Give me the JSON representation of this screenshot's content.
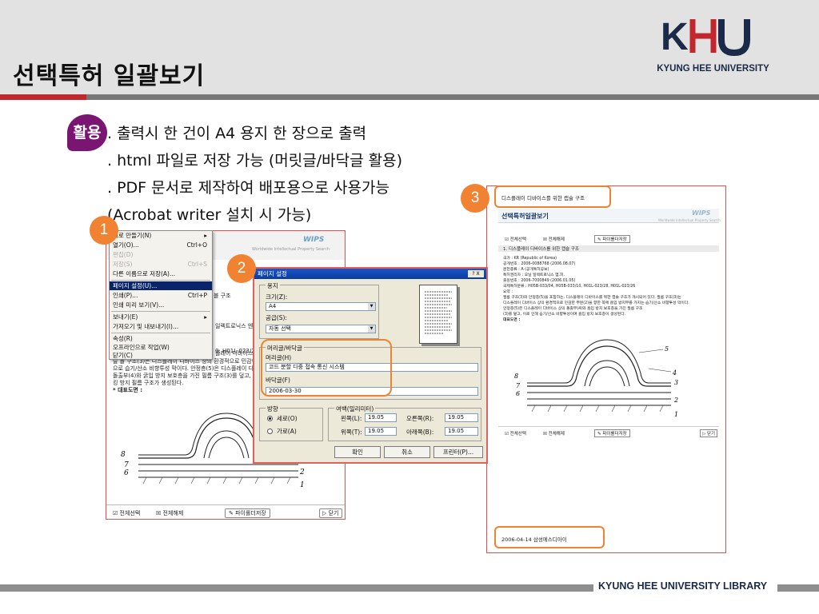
{
  "header": {
    "title": "선택특허 일괄보기",
    "logo_text": "KYUNG HEE UNIVERSITY",
    "logo_mark": "KHU"
  },
  "usage": {
    "badge": "활용",
    "lines": [
      ". 출력시 한 건이 A4 용지 한 장으로 출력",
      ". html 파일로 저장 가능 (머릿글/바닥글 활용)",
      ". PDF 문서로 제작하여 배포용으로 사용가능",
      "(Acrobat writer 설치 시 가능)"
    ]
  },
  "badges": [
    "1",
    "2",
    "3"
  ],
  "window1": {
    "brand": "WIPS",
    "brand_sub": "Worldwide Intellectual Property Search",
    "tab_text": "블 구조",
    "side_text": "일렉트로닉스 엔",
    "side_text2": "0: H01L-023/28)",
    "content_lines": [
      "플레이 디바이스",
      "탈 볼 구조(3)은 디스플레이 디바이스 상의 환경적으로 민감한",
      "으로 습기/산소 비향투성 막이다. 안정층(5)은 디스플레이 디",
      "돌출부(4)와 굵입 방지 보호층을 가진 필름 구조(3)를 덮고, 대",
      "킹 방지 필름 구조가 생성된다."
    ],
    "figure_label": "* 대표도면 :",
    "footer": {
      "select_all": "☑ 전체선택",
      "deselect_all": "☒ 전체해제",
      "save_btn": "✎ 파이롤더저장",
      "close_btn": "▷ 닫기"
    },
    "figure_numbers": {
      "n8": "8",
      "n7": "7",
      "n6": "6",
      "n2": "2",
      "n1": "1"
    }
  },
  "menu": {
    "items": [
      {
        "label": "새로 만들기(N)",
        "shortcut": "▸",
        "state": "normal"
      },
      {
        "label": "열기(O)...",
        "shortcut": "Ctrl+O",
        "state": "normal"
      },
      {
        "label": "편집(D)",
        "shortcut": "",
        "state": "disabled"
      },
      {
        "label": "저장(S)",
        "shortcut": "Ctrl+S",
        "state": "disabled"
      },
      {
        "label": "다른 이름으로 저장(A)...",
        "shortcut": "",
        "state": "normal"
      },
      {
        "label": "페이지 설정(U)...",
        "shortcut": "",
        "state": "selected"
      },
      {
        "label": "인쇄(P)...",
        "shortcut": "Ctrl+P",
        "state": "normal"
      },
      {
        "label": "인쇄 미리 보기(V)...",
        "shortcut": "",
        "state": "normal"
      },
      {
        "label": "보내기(E)",
        "shortcut": "▸",
        "state": "normal"
      },
      {
        "label": "가져오기 및 내보내기(I)...",
        "shortcut": "",
        "state": "normal"
      },
      {
        "label": "속성(R)",
        "shortcut": "",
        "state": "normal"
      },
      {
        "label": "오프라인으로 작업(W)",
        "shortcut": "",
        "state": "normal"
      },
      {
        "label": "닫기(C)",
        "shortcut": "",
        "state": "normal"
      }
    ]
  },
  "dialog": {
    "title": "페이지 설정",
    "help": "? X",
    "paper_group": "용지",
    "size_label": "크기(Z):",
    "size_value": "A4",
    "source_label": "공급(S):",
    "source_value": "자동 선택",
    "hf_group": "머리글/바닥글",
    "header_label": "머리글(H)",
    "header_value": "코드 분할 다중 접속 통신 시스템",
    "footer_label": "바닥글(F)",
    "footer_value": "2006-03-30",
    "orient_group": "방향",
    "portrait": "세로(O)",
    "landscape": "가로(A)",
    "margin_group": "여백(밀리미터)",
    "left_label": "왼쪽(L):",
    "left_value": "19.05",
    "right_label": "오른쪽(R):",
    "right_value": "19.05",
    "top_label": "위쪽(T):",
    "top_value": "19.05",
    "bottom_label": "아래쪽(B):",
    "bottom_value": "19.05",
    "ok": "확인",
    "cancel": "취소",
    "printer": "프린터(P)..."
  },
  "window3": {
    "header_text": "디스플레이 디바이스를 위한 캡슐 구조",
    "title": "선택특허일괄보기",
    "brand": "WIPS",
    "brand_sub": "Worldwide Intellectual Property Search",
    "select_all": "☑ 전체선택",
    "deselect_all": "☒ 전체해제",
    "save_btn": "✎ 파이롤더저장",
    "item_title": "1. 디스플레이 디바이스를 위한 캡슐 구조",
    "info_lines": [
      "국가 : KR (Republic of Korea)",
      "공개번호 : 2006-0088768 (2006.08.07)",
      "문헌종류 : A (공개특허공보)",
      "특허권리자 : 오닐 일렉트로닉스 엠.피.",
      "출원번호 : 2006-7000849 (2006.01.05)",
      "국제특허분류 : H05B-033/04, H05B-033/10, H01L-023/28, H01L-023/26",
      "요약 :",
      "필름 구조(3)와 안정층(5)을 포함하는, 디스플레이 디바이스를 위한 캡슐 구조가 개시되어 있다. 필름 구조(3)는",
      "디스플레이 디바이스 상의 환경적으로 민감한 부분(2)을 향한 쪽에 흡입 방지부를 가지는 습기/산소 비향투성 막이다.",
      "안정층(5)은 디스플레이 디바이스 상의 돌출부(4)와 흡입 방지 보호층을 가진 필름 구조",
      "(3)를 덮고, 이로 인해 습기/산소 비향투성이며 흡입 방지 보호층이 생성된다.",
      "대표도면 :"
    ],
    "footer_date": "2006-04-14 삼성에스디아이",
    "close_btn": "▷ 닫기",
    "figure_numbers": {
      "n5": "5",
      "n4": "4",
      "n3": "3",
      "n8": "8",
      "n7": "7",
      "n6": "6",
      "n2": "2",
      "n1": "1"
    }
  },
  "footer": {
    "brand": "KYUNG HEE UNIVERSITY LIBRARY"
  },
  "colors": {
    "accent_red": "#c1272d",
    "badge_orange": "#f08232",
    "usage_purple": "#7a1572",
    "header_gray": "#e2e2e2"
  }
}
